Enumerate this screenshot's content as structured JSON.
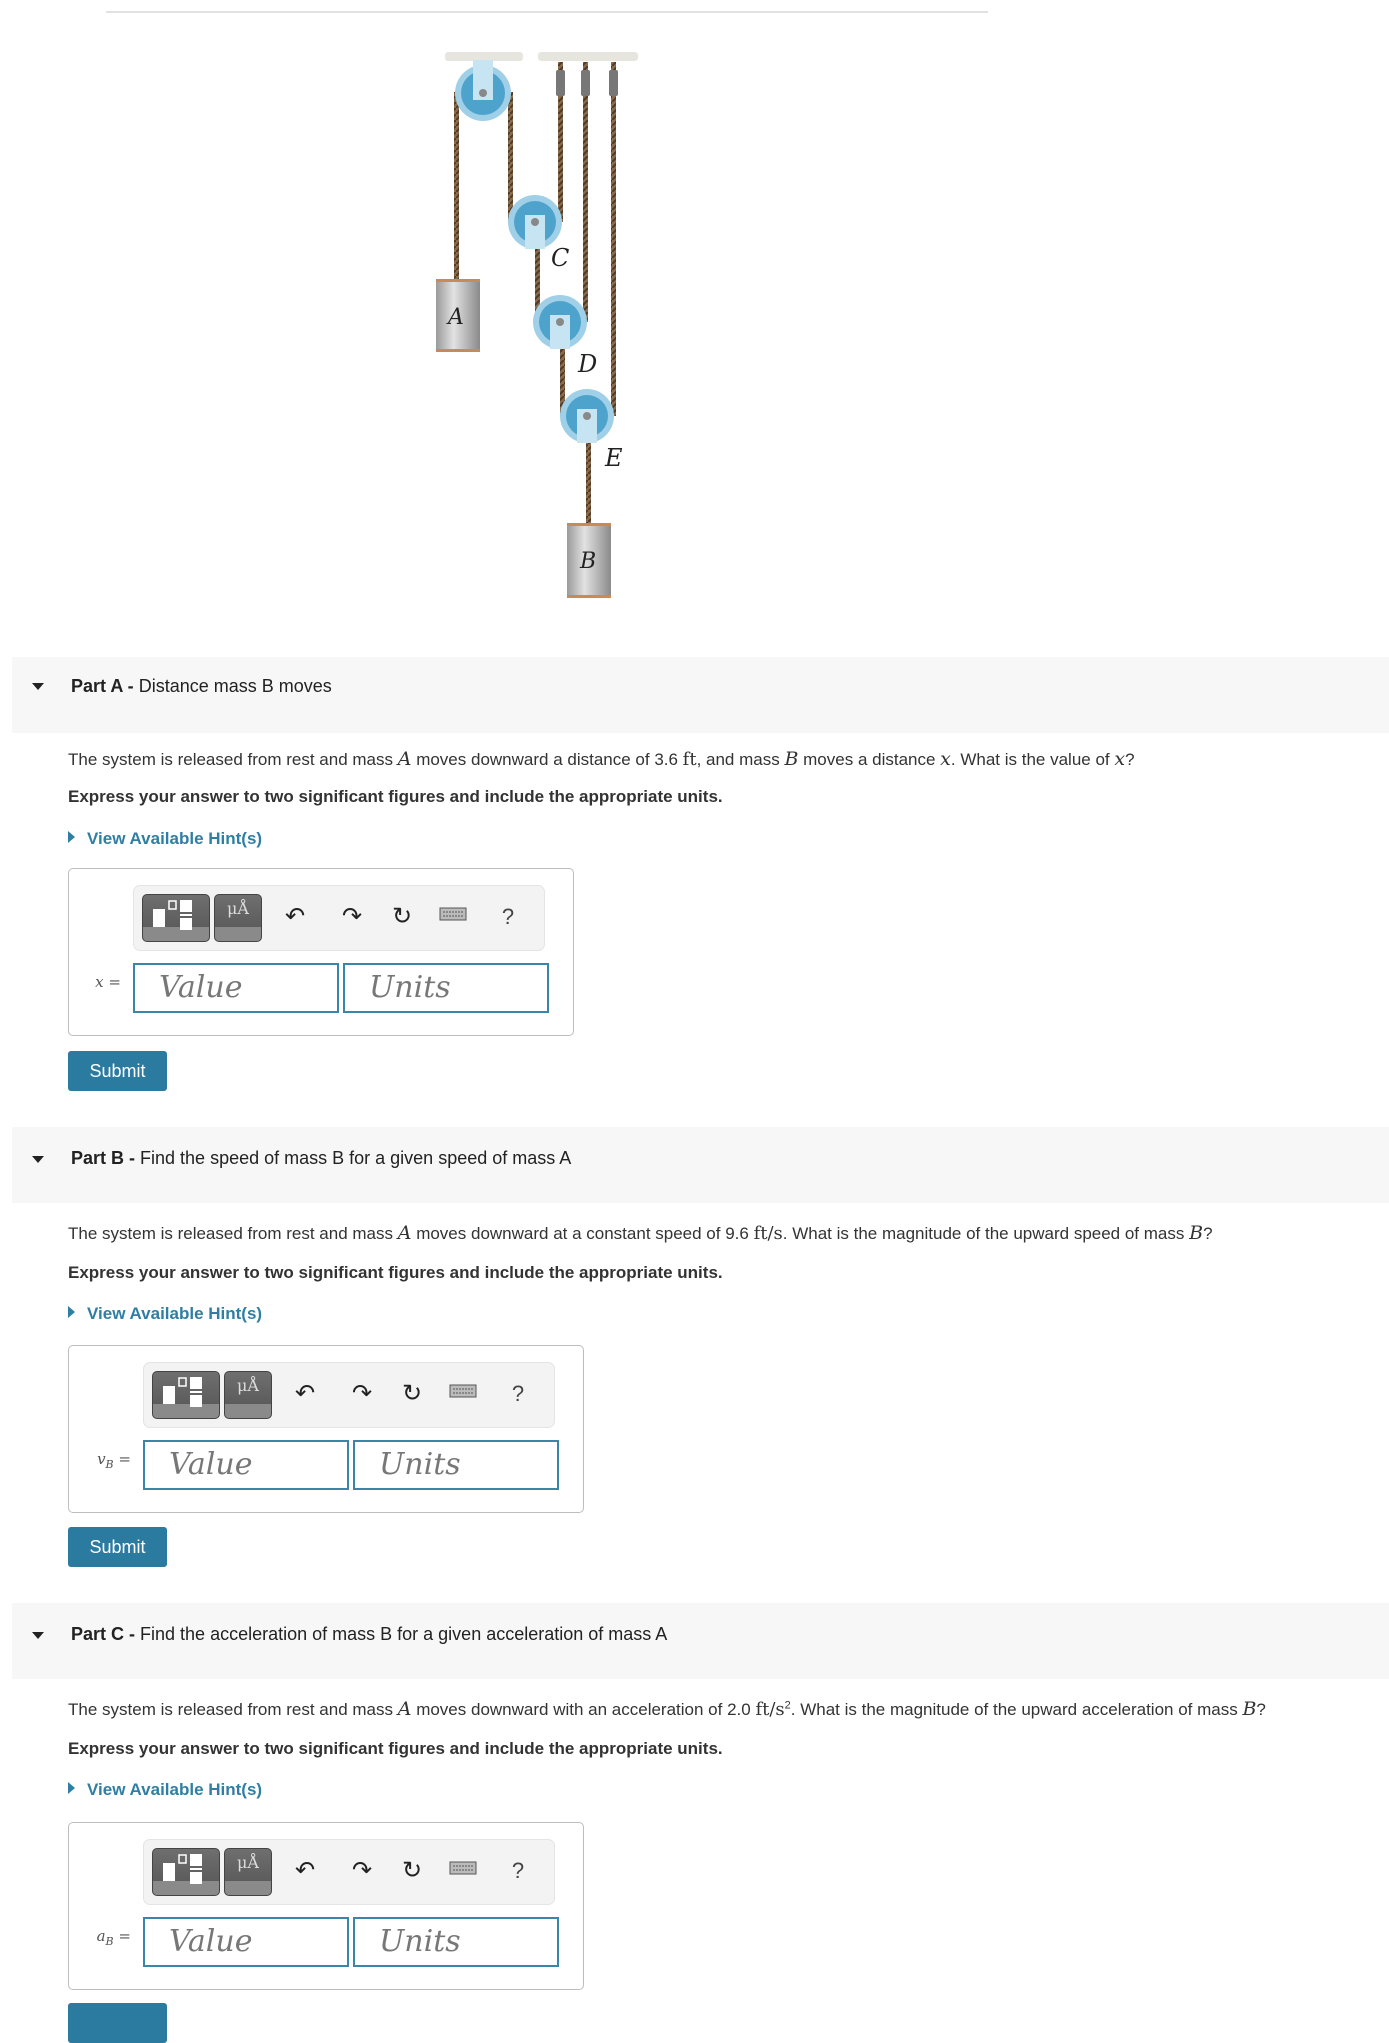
{
  "figure": {
    "labels": {
      "A": "A",
      "B": "B",
      "C": "C",
      "D": "D",
      "E": "E"
    }
  },
  "parts": [
    {
      "prefix": "Part A -",
      "title": "Distance mass B moves",
      "question": {
        "t1": "The system is released from rest and mass ",
        "v1": "A",
        "t2": " moves downward a distance of 3.6 ",
        "u1": "ft",
        "t3": ", and mass ",
        "v2": "B",
        "t4": " moves a distance ",
        "v3": "x",
        "t5": ". What is the value of ",
        "v4": "x",
        "t6": "?"
      },
      "instruction": "Express your answer to two significant figures and include the appropriate units.",
      "hint_label": "View Available Hint(s)",
      "var_label": "x",
      "var_sub": "",
      "value_placeholder": "Value",
      "units_placeholder": "Units",
      "submit_label": "Submit"
    },
    {
      "prefix": "Part B -",
      "title": "Find the speed of mass B for a given speed of mass A",
      "question": {
        "t1": "The system is released from rest and mass ",
        "v1": "A",
        "t2": " moves downward at a constant speed of 9.6 ",
        "u1": "ft/s",
        "t3": ". What is the magnitude of the upward speed of mass ",
        "v2": "B",
        "t4": "?"
      },
      "instruction": "Express your answer to two significant figures and include the appropriate units.",
      "hint_label": "View Available Hint(s)",
      "var_label": "v",
      "var_sub": "B",
      "value_placeholder": "Value",
      "units_placeholder": "Units",
      "submit_label": "Submit"
    },
    {
      "prefix": "Part C -",
      "title": "Find the acceleration of mass B for a given acceleration of mass A",
      "question": {
        "t1": "The system is released from rest and mass ",
        "v1": "A",
        "t2": " moves downward with an acceleration of 2.0 ",
        "u1": "ft/s",
        "u1_sup": "2",
        "t3": ". What is the magnitude of the upward acceleration of mass ",
        "v2": "B",
        "t4": "?"
      },
      "instruction": "Express your answer to two significant figures and include the appropriate units.",
      "hint_label": "View Available Hint(s)",
      "var_label": "a",
      "var_sub": "B",
      "value_placeholder": "Value",
      "units_placeholder": "Units"
    }
  ],
  "toolbar": {
    "units_button_label": "μÅ",
    "undo_icon": "↶",
    "redo_icon": "↷",
    "reset_icon": "↻",
    "keyboard_icon": "⌨",
    "help_label": "?"
  },
  "equals": "="
}
